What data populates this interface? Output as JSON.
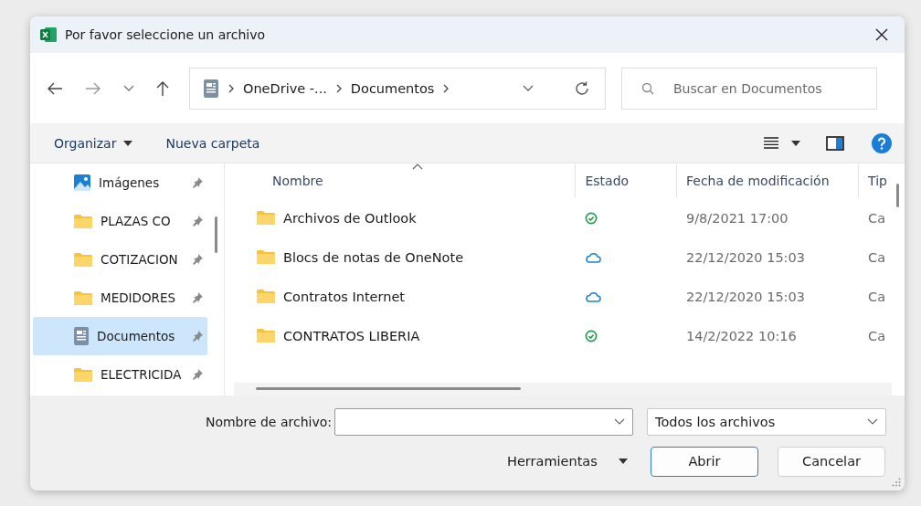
{
  "window": {
    "title": "Por favor seleccione un archivo"
  },
  "address": {
    "crumbs": [
      "OneDrive -...",
      "Documentos"
    ]
  },
  "search": {
    "placeholder": "Buscar en Documentos"
  },
  "toolbar": {
    "organize": "Organizar",
    "new_folder": "Nueva carpeta"
  },
  "sidebar": {
    "items": [
      {
        "label": "Imágenes",
        "kind": "pictures",
        "pinned": true,
        "selected": false
      },
      {
        "label": "PLAZAS CO",
        "kind": "folder",
        "pinned": true,
        "selected": false
      },
      {
        "label": "COTIZACION",
        "kind": "folder",
        "pinned": true,
        "selected": false
      },
      {
        "label": "MEDIDORES",
        "kind": "folder",
        "pinned": true,
        "selected": false
      },
      {
        "label": "Documentos",
        "kind": "documents",
        "pinned": true,
        "selected": true
      },
      {
        "label": "ELECTRICIDA",
        "kind": "folder",
        "pinned": true,
        "selected": false
      }
    ]
  },
  "files": {
    "columns": [
      {
        "label": "Nombre",
        "sorted": true
      },
      {
        "label": "Estado",
        "sorted": false
      },
      {
        "label": "Fecha de modificación",
        "sorted": false
      },
      {
        "label": "Tip",
        "sorted": false
      }
    ],
    "rows": [
      {
        "name": "Archivos de Outlook",
        "synced": true,
        "modified": "9/8/2021 17:00",
        "type": "Ca"
      },
      {
        "name": "Blocs de notas de OneNote",
        "synced": false,
        "modified": "22/12/2020 15:03",
        "type": "Ca"
      },
      {
        "name": "Contratos Internet",
        "synced": false,
        "modified": "22/12/2020 15:03",
        "type": "Ca"
      },
      {
        "name": "CONTRATOS LIBERIA",
        "synced": true,
        "modified": "14/2/2022 10:16",
        "type": "Ca"
      }
    ]
  },
  "footer": {
    "filename_label": "Nombre de archivo:",
    "filter": "Todos los archivos",
    "tools": "Herramientas",
    "buttons": [
      {
        "label": "Abrir",
        "default": true
      },
      {
        "label": "Cancelar",
        "default": false
      }
    ]
  }
}
